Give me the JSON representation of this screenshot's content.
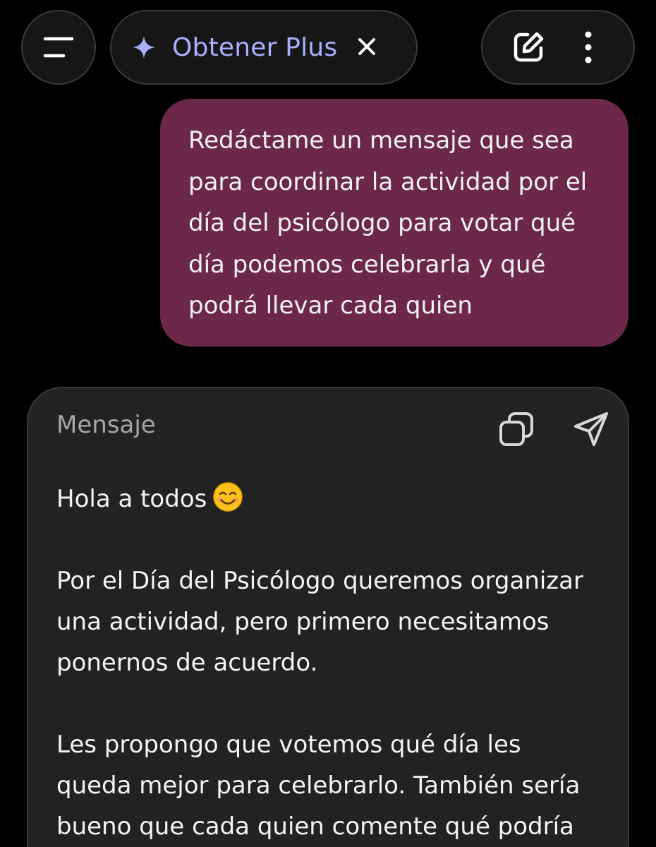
{
  "header": {
    "menu_icon": "menu-icon",
    "plus_icon": "sparkle-icon",
    "plus_label": "Obtener Plus",
    "close_icon": "close-icon",
    "edit_icon": "new-chat-icon",
    "more_icon": "more-vertical-icon"
  },
  "user_message": {
    "text": "Redáctame un mensaje que sea\npara coordinar la actividad por el\ndía del psicólogo para votar qué\ndía podemos celebrarla y qué\npodrá llevar cada quien"
  },
  "assistant_card": {
    "title": "Mensaje",
    "copy_icon": "copy-icon",
    "send_icon": "send-icon",
    "greeting": "Hola a todos",
    "greeting_emoji": "smiling-face-emoji",
    "paragraphs": [
      "Por el Día del Psicólogo queremos organizar\nuna actividad, pero primero necesitamos\nponernos de acuerdo.",
      "Les propongo que votemos qué día les\nqueda mejor para celebrarlo. También sería\nbueno que cada quien comente qué podría"
    ]
  },
  "colors": {
    "background": "#000000",
    "pill_bg": "#161616",
    "accent_plus": "#a8b0ff",
    "user_bubble": "#6b2848",
    "card_bg": "#222222"
  }
}
